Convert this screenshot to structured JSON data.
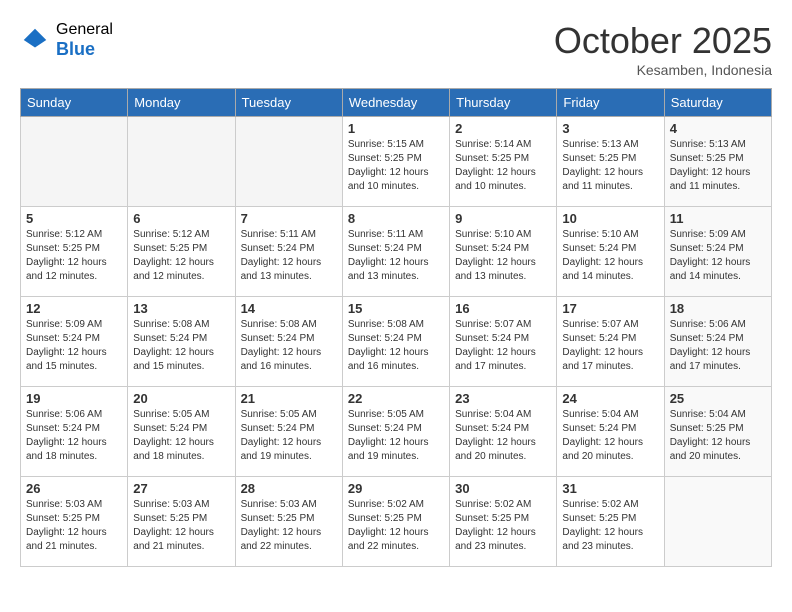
{
  "logo": {
    "general": "General",
    "blue": "Blue"
  },
  "title": "October 2025",
  "location": "Kesamben, Indonesia",
  "days_of_week": [
    "Sunday",
    "Monday",
    "Tuesday",
    "Wednesday",
    "Thursday",
    "Friday",
    "Saturday"
  ],
  "weeks": [
    [
      {
        "day": "",
        "info": ""
      },
      {
        "day": "",
        "info": ""
      },
      {
        "day": "",
        "info": ""
      },
      {
        "day": "1",
        "info": "Sunrise: 5:15 AM\nSunset: 5:25 PM\nDaylight: 12 hours\nand 10 minutes."
      },
      {
        "day": "2",
        "info": "Sunrise: 5:14 AM\nSunset: 5:25 PM\nDaylight: 12 hours\nand 10 minutes."
      },
      {
        "day": "3",
        "info": "Sunrise: 5:13 AM\nSunset: 5:25 PM\nDaylight: 12 hours\nand 11 minutes."
      },
      {
        "day": "4",
        "info": "Sunrise: 5:13 AM\nSunset: 5:25 PM\nDaylight: 12 hours\nand 11 minutes."
      }
    ],
    [
      {
        "day": "5",
        "info": "Sunrise: 5:12 AM\nSunset: 5:25 PM\nDaylight: 12 hours\nand 12 minutes."
      },
      {
        "day": "6",
        "info": "Sunrise: 5:12 AM\nSunset: 5:25 PM\nDaylight: 12 hours\nand 12 minutes."
      },
      {
        "day": "7",
        "info": "Sunrise: 5:11 AM\nSunset: 5:24 PM\nDaylight: 12 hours\nand 13 minutes."
      },
      {
        "day": "8",
        "info": "Sunrise: 5:11 AM\nSunset: 5:24 PM\nDaylight: 12 hours\nand 13 minutes."
      },
      {
        "day": "9",
        "info": "Sunrise: 5:10 AM\nSunset: 5:24 PM\nDaylight: 12 hours\nand 13 minutes."
      },
      {
        "day": "10",
        "info": "Sunrise: 5:10 AM\nSunset: 5:24 PM\nDaylight: 12 hours\nand 14 minutes."
      },
      {
        "day": "11",
        "info": "Sunrise: 5:09 AM\nSunset: 5:24 PM\nDaylight: 12 hours\nand 14 minutes."
      }
    ],
    [
      {
        "day": "12",
        "info": "Sunrise: 5:09 AM\nSunset: 5:24 PM\nDaylight: 12 hours\nand 15 minutes."
      },
      {
        "day": "13",
        "info": "Sunrise: 5:08 AM\nSunset: 5:24 PM\nDaylight: 12 hours\nand 15 minutes."
      },
      {
        "day": "14",
        "info": "Sunrise: 5:08 AM\nSunset: 5:24 PM\nDaylight: 12 hours\nand 16 minutes."
      },
      {
        "day": "15",
        "info": "Sunrise: 5:08 AM\nSunset: 5:24 PM\nDaylight: 12 hours\nand 16 minutes."
      },
      {
        "day": "16",
        "info": "Sunrise: 5:07 AM\nSunset: 5:24 PM\nDaylight: 12 hours\nand 17 minutes."
      },
      {
        "day": "17",
        "info": "Sunrise: 5:07 AM\nSunset: 5:24 PM\nDaylight: 12 hours\nand 17 minutes."
      },
      {
        "day": "18",
        "info": "Sunrise: 5:06 AM\nSunset: 5:24 PM\nDaylight: 12 hours\nand 17 minutes."
      }
    ],
    [
      {
        "day": "19",
        "info": "Sunrise: 5:06 AM\nSunset: 5:24 PM\nDaylight: 12 hours\nand 18 minutes."
      },
      {
        "day": "20",
        "info": "Sunrise: 5:05 AM\nSunset: 5:24 PM\nDaylight: 12 hours\nand 18 minutes."
      },
      {
        "day": "21",
        "info": "Sunrise: 5:05 AM\nSunset: 5:24 PM\nDaylight: 12 hours\nand 19 minutes."
      },
      {
        "day": "22",
        "info": "Sunrise: 5:05 AM\nSunset: 5:24 PM\nDaylight: 12 hours\nand 19 minutes."
      },
      {
        "day": "23",
        "info": "Sunrise: 5:04 AM\nSunset: 5:24 PM\nDaylight: 12 hours\nand 20 minutes."
      },
      {
        "day": "24",
        "info": "Sunrise: 5:04 AM\nSunset: 5:24 PM\nDaylight: 12 hours\nand 20 minutes."
      },
      {
        "day": "25",
        "info": "Sunrise: 5:04 AM\nSunset: 5:25 PM\nDaylight: 12 hours\nand 20 minutes."
      }
    ],
    [
      {
        "day": "26",
        "info": "Sunrise: 5:03 AM\nSunset: 5:25 PM\nDaylight: 12 hours\nand 21 minutes."
      },
      {
        "day": "27",
        "info": "Sunrise: 5:03 AM\nSunset: 5:25 PM\nDaylight: 12 hours\nand 21 minutes."
      },
      {
        "day": "28",
        "info": "Sunrise: 5:03 AM\nSunset: 5:25 PM\nDaylight: 12 hours\nand 22 minutes."
      },
      {
        "day": "29",
        "info": "Sunrise: 5:02 AM\nSunset: 5:25 PM\nDaylight: 12 hours\nand 22 minutes."
      },
      {
        "day": "30",
        "info": "Sunrise: 5:02 AM\nSunset: 5:25 PM\nDaylight: 12 hours\nand 23 minutes."
      },
      {
        "day": "31",
        "info": "Sunrise: 5:02 AM\nSunset: 5:25 PM\nDaylight: 12 hours\nand 23 minutes."
      },
      {
        "day": "",
        "info": ""
      }
    ]
  ]
}
